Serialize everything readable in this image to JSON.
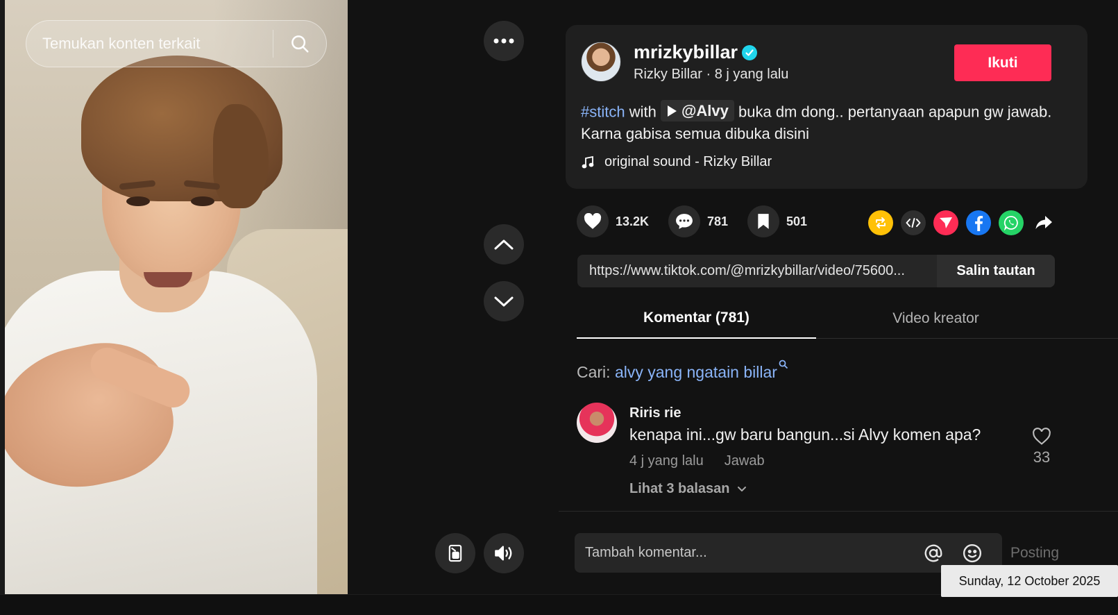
{
  "video": {
    "search_placeholder": "Temukan konten terkait"
  },
  "post": {
    "username": "mrizkybillar",
    "display_name": "Rizky Billar",
    "time_ago": "8 j yang lalu",
    "separator": " · ",
    "follow_label": "Ikuti",
    "caption": {
      "hashtag": "#stitch",
      "with_text": " with ",
      "mention": "@Alvy",
      "text": " buka dm dong.. pertanyaan apapun gw jawab. Karna gabisa semua dibuka disini"
    },
    "sound": "original sound - Rizky Billar"
  },
  "stats": {
    "likes": "13.2K",
    "comments": "781",
    "saves": "501"
  },
  "share": {
    "link": "https://www.tiktok.com/@mrizkybillar/video/75600...",
    "copy_label": "Salin tautan",
    "colors": {
      "repost": "#ffc107",
      "embed": "#2f2f2f",
      "send": "#fe2c55",
      "facebook": "#1877f2",
      "whatsapp": "#25d366"
    }
  },
  "tabs": {
    "comments_label": "Komentar (781)",
    "creator_videos_label": "Video kreator"
  },
  "search_hint": {
    "prefix": "Cari: ",
    "query": "alvy yang ngatain billar"
  },
  "comments": [
    {
      "user": "Riris rie",
      "text": "kenapa ini...gw baru bangun...si Alvy komen apa?",
      "time": "4 j yang lalu",
      "reply_label": "Jawab",
      "replies_label": "Lihat 3 balasan",
      "likes": "33"
    }
  ],
  "composer": {
    "placeholder": "Tambah komentar...",
    "post_label": "Posting"
  },
  "system": {
    "clock": "Sunday, 12 October 2025"
  },
  "colors": {
    "accent": "#fe2c55",
    "verified": "#20d5ec",
    "link": "#8ab4f8"
  }
}
